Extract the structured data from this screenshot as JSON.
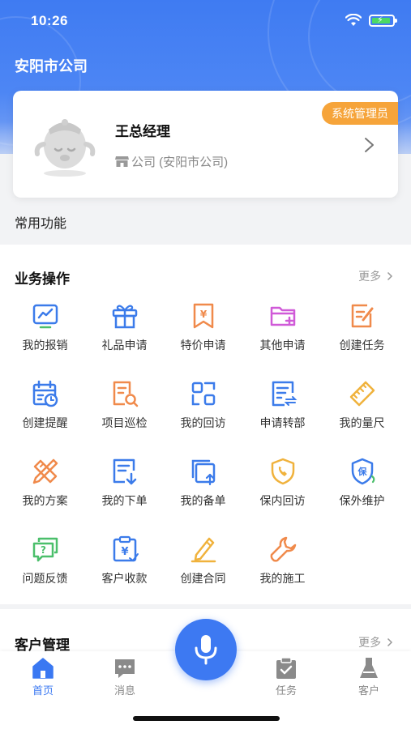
{
  "status_bar": {
    "time": "10:26"
  },
  "header": {
    "company": "安阳市公司"
  },
  "profile": {
    "name": "王总经理",
    "role_badge": "系统管理员",
    "company": "公司 (安阳市公司)"
  },
  "common_functions_label": "常用功能",
  "business": {
    "title": "业务操作",
    "more": "更多",
    "items": [
      {
        "label": "我的报销",
        "icon": "chart-board-icon"
      },
      {
        "label": "礼品申请",
        "icon": "gift-icon"
      },
      {
        "label": "特价申请",
        "icon": "yen-bookmark-icon"
      },
      {
        "label": "其他申请",
        "icon": "folder-add-icon"
      },
      {
        "label": "创建任务",
        "icon": "edit-document-icon"
      },
      {
        "label": "创建提醒",
        "icon": "calendar-clock-icon"
      },
      {
        "label": "项目巡检",
        "icon": "document-search-icon"
      },
      {
        "label": "我的回访",
        "icon": "scan-icon"
      },
      {
        "label": "申请转部",
        "icon": "transfer-document-icon"
      },
      {
        "label": "我的量尺",
        "icon": "ruler-icon"
      },
      {
        "label": "我的方案",
        "icon": "ruler-pencil-icon"
      },
      {
        "label": "我的下单",
        "icon": "order-download-icon"
      },
      {
        "label": "我的备单",
        "icon": "copy-upload-icon"
      },
      {
        "label": "保内回访",
        "icon": "shield-phone-icon"
      },
      {
        "label": "保外维护",
        "icon": "shield-refresh-icon"
      },
      {
        "label": "问题反馈",
        "icon": "feedback-icon"
      },
      {
        "label": "客户收款",
        "icon": "clipboard-yen-icon"
      },
      {
        "label": "创建合同",
        "icon": "pen-sign-icon"
      },
      {
        "label": "我的施工",
        "icon": "wrench-icon"
      }
    ]
  },
  "customer": {
    "title": "客户管理",
    "more": "更多"
  },
  "tabs": [
    {
      "label": "首页",
      "icon": "home-icon",
      "active": true
    },
    {
      "label": "消息",
      "icon": "message-icon",
      "active": false
    },
    {
      "label": "任务",
      "icon": "task-icon",
      "active": false
    },
    {
      "label": "客户",
      "icon": "customer-icon",
      "active": false
    }
  ],
  "colors": {
    "primary": "#3d79f2",
    "icon_blue": "#3b7bea",
    "icon_orange": "#f08a4b",
    "icon_pink": "#d05ad8",
    "icon_yellow": "#f0b23c",
    "icon_green": "#4bbf6b",
    "badge": "#f6a43a"
  }
}
